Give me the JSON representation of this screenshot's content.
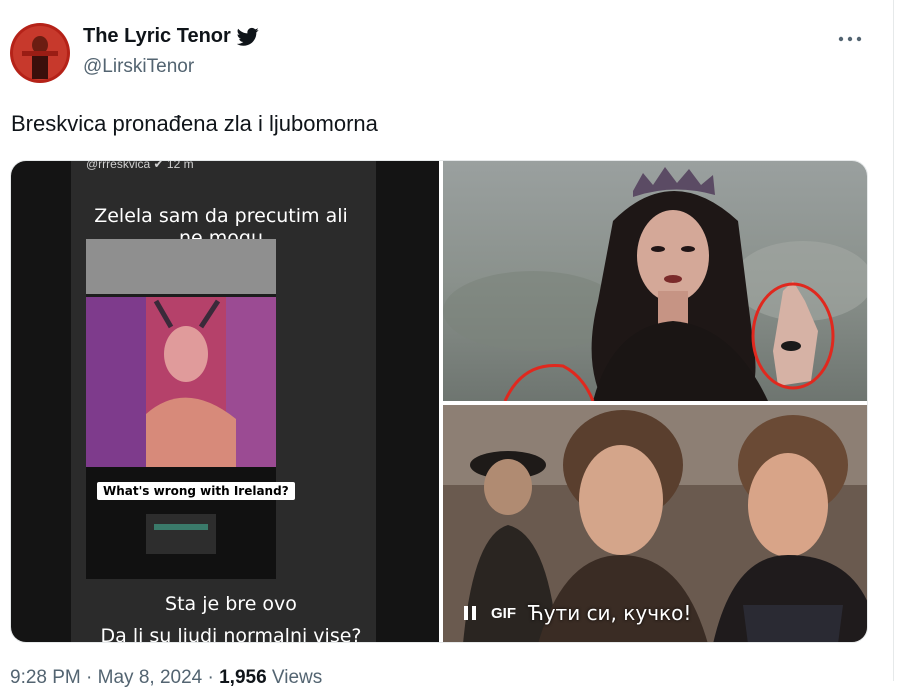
{
  "author": {
    "display_name": "The Lyric Tenor",
    "handle": "@LirskiTenor"
  },
  "tweet": {
    "text": "Breskvica pronađena zla i ljubomorna"
  },
  "media": {
    "story": {
      "header": "@rrreskvica ✔ 12 m",
      "line1": "Zelela sam da precutim ali ne mogu",
      "caption": "What's wrong with Ireland?",
      "line2": "Sta je bre ovo",
      "line3": "Da li su ljudi normalni vise?"
    },
    "gif": {
      "badge": "GIF",
      "subtitle": "Ћути си, кучко!"
    }
  },
  "footer": {
    "time": "9:28 PM · May 8, 2024 · ",
    "views_count": "1,956",
    "views_label": " Views"
  },
  "icons": {
    "verified": "twitter-bird-icon",
    "more": "more-icon",
    "pause": "pause-icon"
  },
  "colors": {
    "text": "#0f1419",
    "secondary": "#536471",
    "annotation": "#e0281e"
  }
}
